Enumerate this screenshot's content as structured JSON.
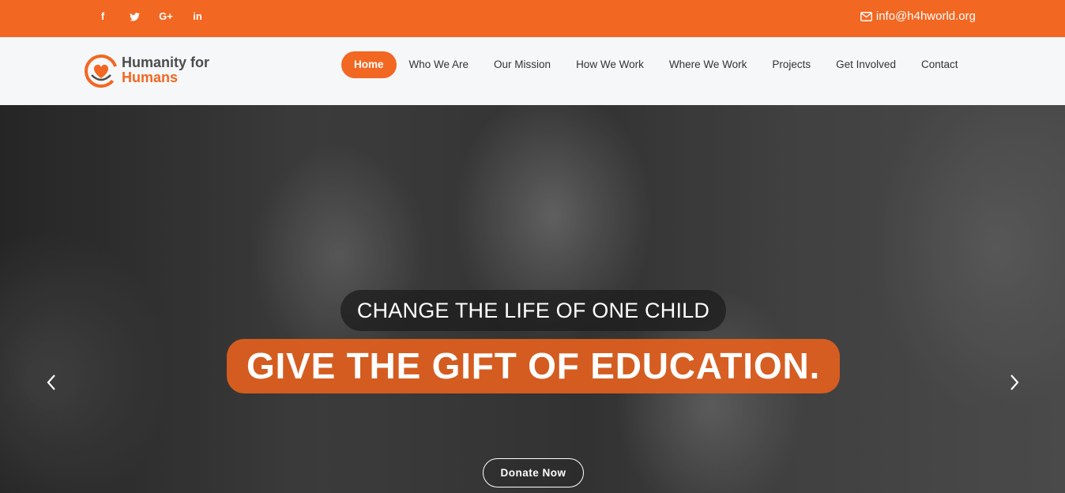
{
  "topbar": {
    "social": [
      {
        "icon": "facebook-icon",
        "glyph": "f"
      },
      {
        "icon": "twitter-icon",
        "glyph": ""
      },
      {
        "icon": "google-plus-icon",
        "glyph": "G+"
      },
      {
        "icon": "linkedin-icon",
        "glyph": "in"
      }
    ],
    "email": "info@h4hworld.org",
    "color": "#f26722"
  },
  "logo": {
    "line1": "Humanity for",
    "line2": "Humans"
  },
  "nav": {
    "items": [
      {
        "label": "Home",
        "active": true
      },
      {
        "label": "Who We Are"
      },
      {
        "label": "Our Mission"
      },
      {
        "label": "How We Work"
      },
      {
        "label": "Where We Work"
      },
      {
        "label": "Projects"
      },
      {
        "label": "Get Involved"
      },
      {
        "label": "Contact"
      }
    ]
  },
  "hero": {
    "tagline": "CHANGE THE LIFE OF ONE CHILD",
    "headline": "GIVE THE GIFT OF EDUCATION.",
    "cta": "Donate Now",
    "prev_icon": "chevron-left-icon",
    "next_icon": "chevron-right-icon"
  }
}
